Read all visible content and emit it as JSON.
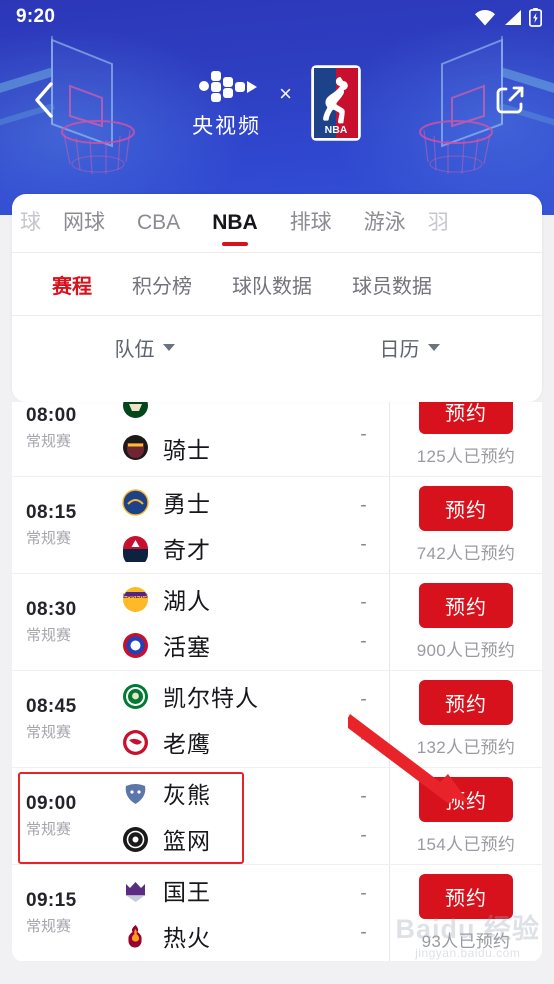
{
  "status_bar": {
    "time": "9:20",
    "icons": [
      "wifi-icon",
      "cellular-signal-icon",
      "battery-charging-icon"
    ]
  },
  "header": {
    "back_icon": "back-chevron-icon",
    "share_icon": "external-link-icon",
    "brand_primary": "央视频",
    "brand_separator": "×",
    "brand_secondary": "NBA",
    "background_art": "basketball-hoop-illustration",
    "bg_color": "#2e3fc2"
  },
  "sport_tabs": {
    "items": [
      {
        "label": "球",
        "active": false,
        "partial": true
      },
      {
        "label": "网球",
        "active": false,
        "partial": false
      },
      {
        "label": "CBA",
        "active": false,
        "partial": false
      },
      {
        "label": "NBA",
        "active": true,
        "partial": false
      },
      {
        "label": "排球",
        "active": false,
        "partial": false
      },
      {
        "label": "游泳",
        "active": false,
        "partial": false
      },
      {
        "label": "羽",
        "active": false,
        "partial": true
      }
    ],
    "active_color": "#d8121c"
  },
  "sub_tabs": {
    "items": [
      {
        "label": "赛程",
        "active": true
      },
      {
        "label": "积分榜",
        "active": false
      },
      {
        "label": "球队数据",
        "active": false
      },
      {
        "label": "球员数据",
        "active": false
      }
    ]
  },
  "filters": [
    {
      "label": "队伍",
      "icon": "chevron-down-icon"
    },
    {
      "label": "日历",
      "icon": "chevron-down-icon"
    }
  ],
  "games": [
    {
      "time": "08:00",
      "stage": "常规赛",
      "team_home": {
        "name": "",
        "logo": "bucks-logo",
        "score": ""
      },
      "team_away": {
        "name": "骑士",
        "logo": "cavaliers-logo",
        "score": "-"
      },
      "button_label": "预约",
      "book_count": "125人已预约",
      "highlighted": false,
      "clipped_top": true
    },
    {
      "time": "08:15",
      "stage": "常规赛",
      "team_home": {
        "name": "勇士",
        "logo": "warriors-logo",
        "score": "-"
      },
      "team_away": {
        "name": "奇才",
        "logo": "wizards-logo",
        "score": "-"
      },
      "button_label": "预约",
      "book_count": "742人已预约",
      "highlighted": false,
      "clipped_top": false
    },
    {
      "time": "08:30",
      "stage": "常规赛",
      "team_home": {
        "name": "湖人",
        "logo": "lakers-logo",
        "score": "-"
      },
      "team_away": {
        "name": "活塞",
        "logo": "pistons-logo",
        "score": "-"
      },
      "button_label": "预约",
      "book_count": "900人已预约",
      "highlighted": false,
      "clipped_top": false
    },
    {
      "time": "08:45",
      "stage": "常规赛",
      "team_home": {
        "name": "凯尔特人",
        "logo": "celtics-logo",
        "score": "-"
      },
      "team_away": {
        "name": "老鹰",
        "logo": "hawks-logo",
        "score": "-"
      },
      "button_label": "预约",
      "book_count": "132人已预约",
      "highlighted": false,
      "clipped_top": false
    },
    {
      "time": "09:00",
      "stage": "常规赛",
      "team_home": {
        "name": "灰熊",
        "logo": "grizzlies-logo",
        "score": "-"
      },
      "team_away": {
        "name": "篮网",
        "logo": "nets-logo",
        "score": "-"
      },
      "button_label": "预约",
      "book_count": "154人已预约",
      "highlighted": true,
      "clipped_top": false
    },
    {
      "time": "09:15",
      "stage": "常规赛",
      "team_home": {
        "name": "国王",
        "logo": "kings-logo",
        "score": "-"
      },
      "team_away": {
        "name": "热火",
        "logo": "heat-logo",
        "score": "-"
      },
      "button_label": "预约",
      "book_count": "93人已预约",
      "highlighted": false,
      "clipped_top": false
    }
  ],
  "annotation": {
    "box_target": "09:00 灰熊 vs 篮网 row",
    "arrow_target": "reserve-button of 09:00 game",
    "color": "#e8232a"
  },
  "watermark": {
    "line1": "Baidu 经验",
    "line2": "jingyan.baidu.com"
  },
  "team_logo_colors": {
    "cavaliers-logo": "#6f2633",
    "warriors-logo": "#1d428a",
    "wizards-logo": "#c8102e",
    "lakers-logo": "#fdb927",
    "pistons-logo": "#1d42ba",
    "celtics-logo": "#007a33",
    "hawks-logo": "#c8102e",
    "grizzlies-logo": "#5d76a9",
    "nets-logo": "#1a1a1a",
    "kings-logo": "#5a2d81",
    "heat-logo": "#98002e",
    "bucks-logo": "#00471b"
  }
}
